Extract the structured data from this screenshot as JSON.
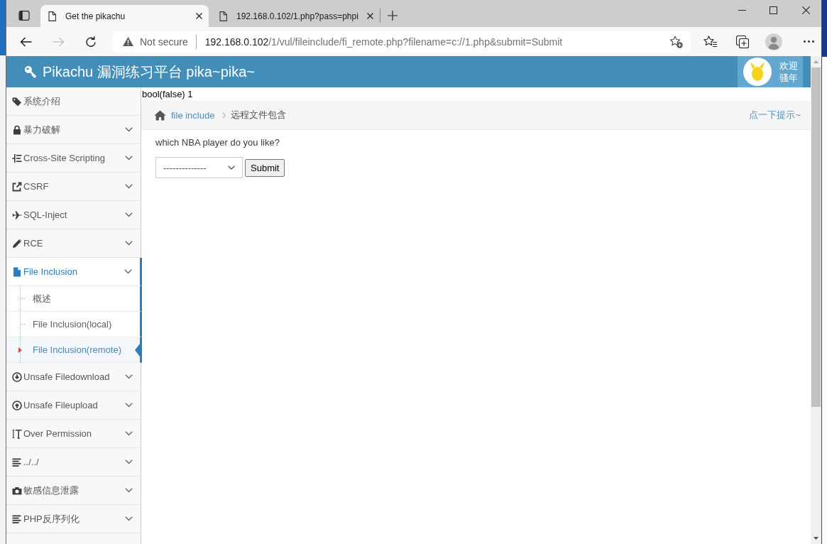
{
  "browser": {
    "tabs": [
      {
        "title": "Get the pikachu",
        "selected": true
      },
      {
        "title": "192.168.0.102/1.php?pass=phpi",
        "selected": false
      }
    ],
    "nav_buttons": [
      {
        "kind": "back",
        "disabled": false
      },
      {
        "kind": "forward",
        "disabled": true
      },
      {
        "kind": "refresh",
        "disabled": false
      }
    ],
    "address_bar": {
      "security": "Not secure",
      "url": "192.168.0.102/1/vul/fileinclude/fi_remote.php?filename=c://1.php&submit=Submit"
    }
  },
  "header": {
    "title": "Pikachu 漏洞练习平台 pika~pika~",
    "greeting": [
      "欢迎",
      "骚年"
    ]
  },
  "sidebar": {
    "items": [
      {
        "label": "系统介绍",
        "kind": "link",
        "selected": false
      },
      {
        "label": "暴力破解",
        "kind": "menu",
        "selected": false
      },
      {
        "label": "Cross-Site Scripting",
        "kind": "menu",
        "selected": false
      },
      {
        "label": "CSRF",
        "kind": "menu",
        "selected": false
      },
      {
        "label": "SQL-Inject",
        "kind": "menu",
        "selected": false
      },
      {
        "label": "RCE",
        "kind": "menu",
        "selected": false
      },
      {
        "label": "File Inclusion",
        "kind": "menu",
        "selected": true,
        "children": [
          {
            "label": "概述",
            "selected": false
          },
          {
            "label": "File Inclusion(local)",
            "selected": false
          },
          {
            "label": "File Inclusion(remote)",
            "selected": true
          }
        ]
      },
      {
        "label": "Unsafe Filedownload",
        "kind": "menu",
        "selected": false
      },
      {
        "label": "Unsafe Fileupload",
        "kind": "menu",
        "selected": false
      },
      {
        "label": "Over Permission",
        "kind": "menu",
        "selected": false
      },
      {
        "label": "../../",
        "kind": "menu",
        "selected": false
      },
      {
        "label": "敏感信息泄露",
        "kind": "menu",
        "selected": false
      },
      {
        "label": "PHP反序列化",
        "kind": "menu",
        "selected": false
      }
    ]
  },
  "debug_output": "bool(false) 1",
  "breadcrumb": {
    "link": "file include",
    "current": "远程文件包含",
    "hint": "点一下提示~"
  },
  "form": {
    "question": "which NBA player do you like?",
    "select": {
      "value": "--------------"
    },
    "submit": "Submit"
  }
}
